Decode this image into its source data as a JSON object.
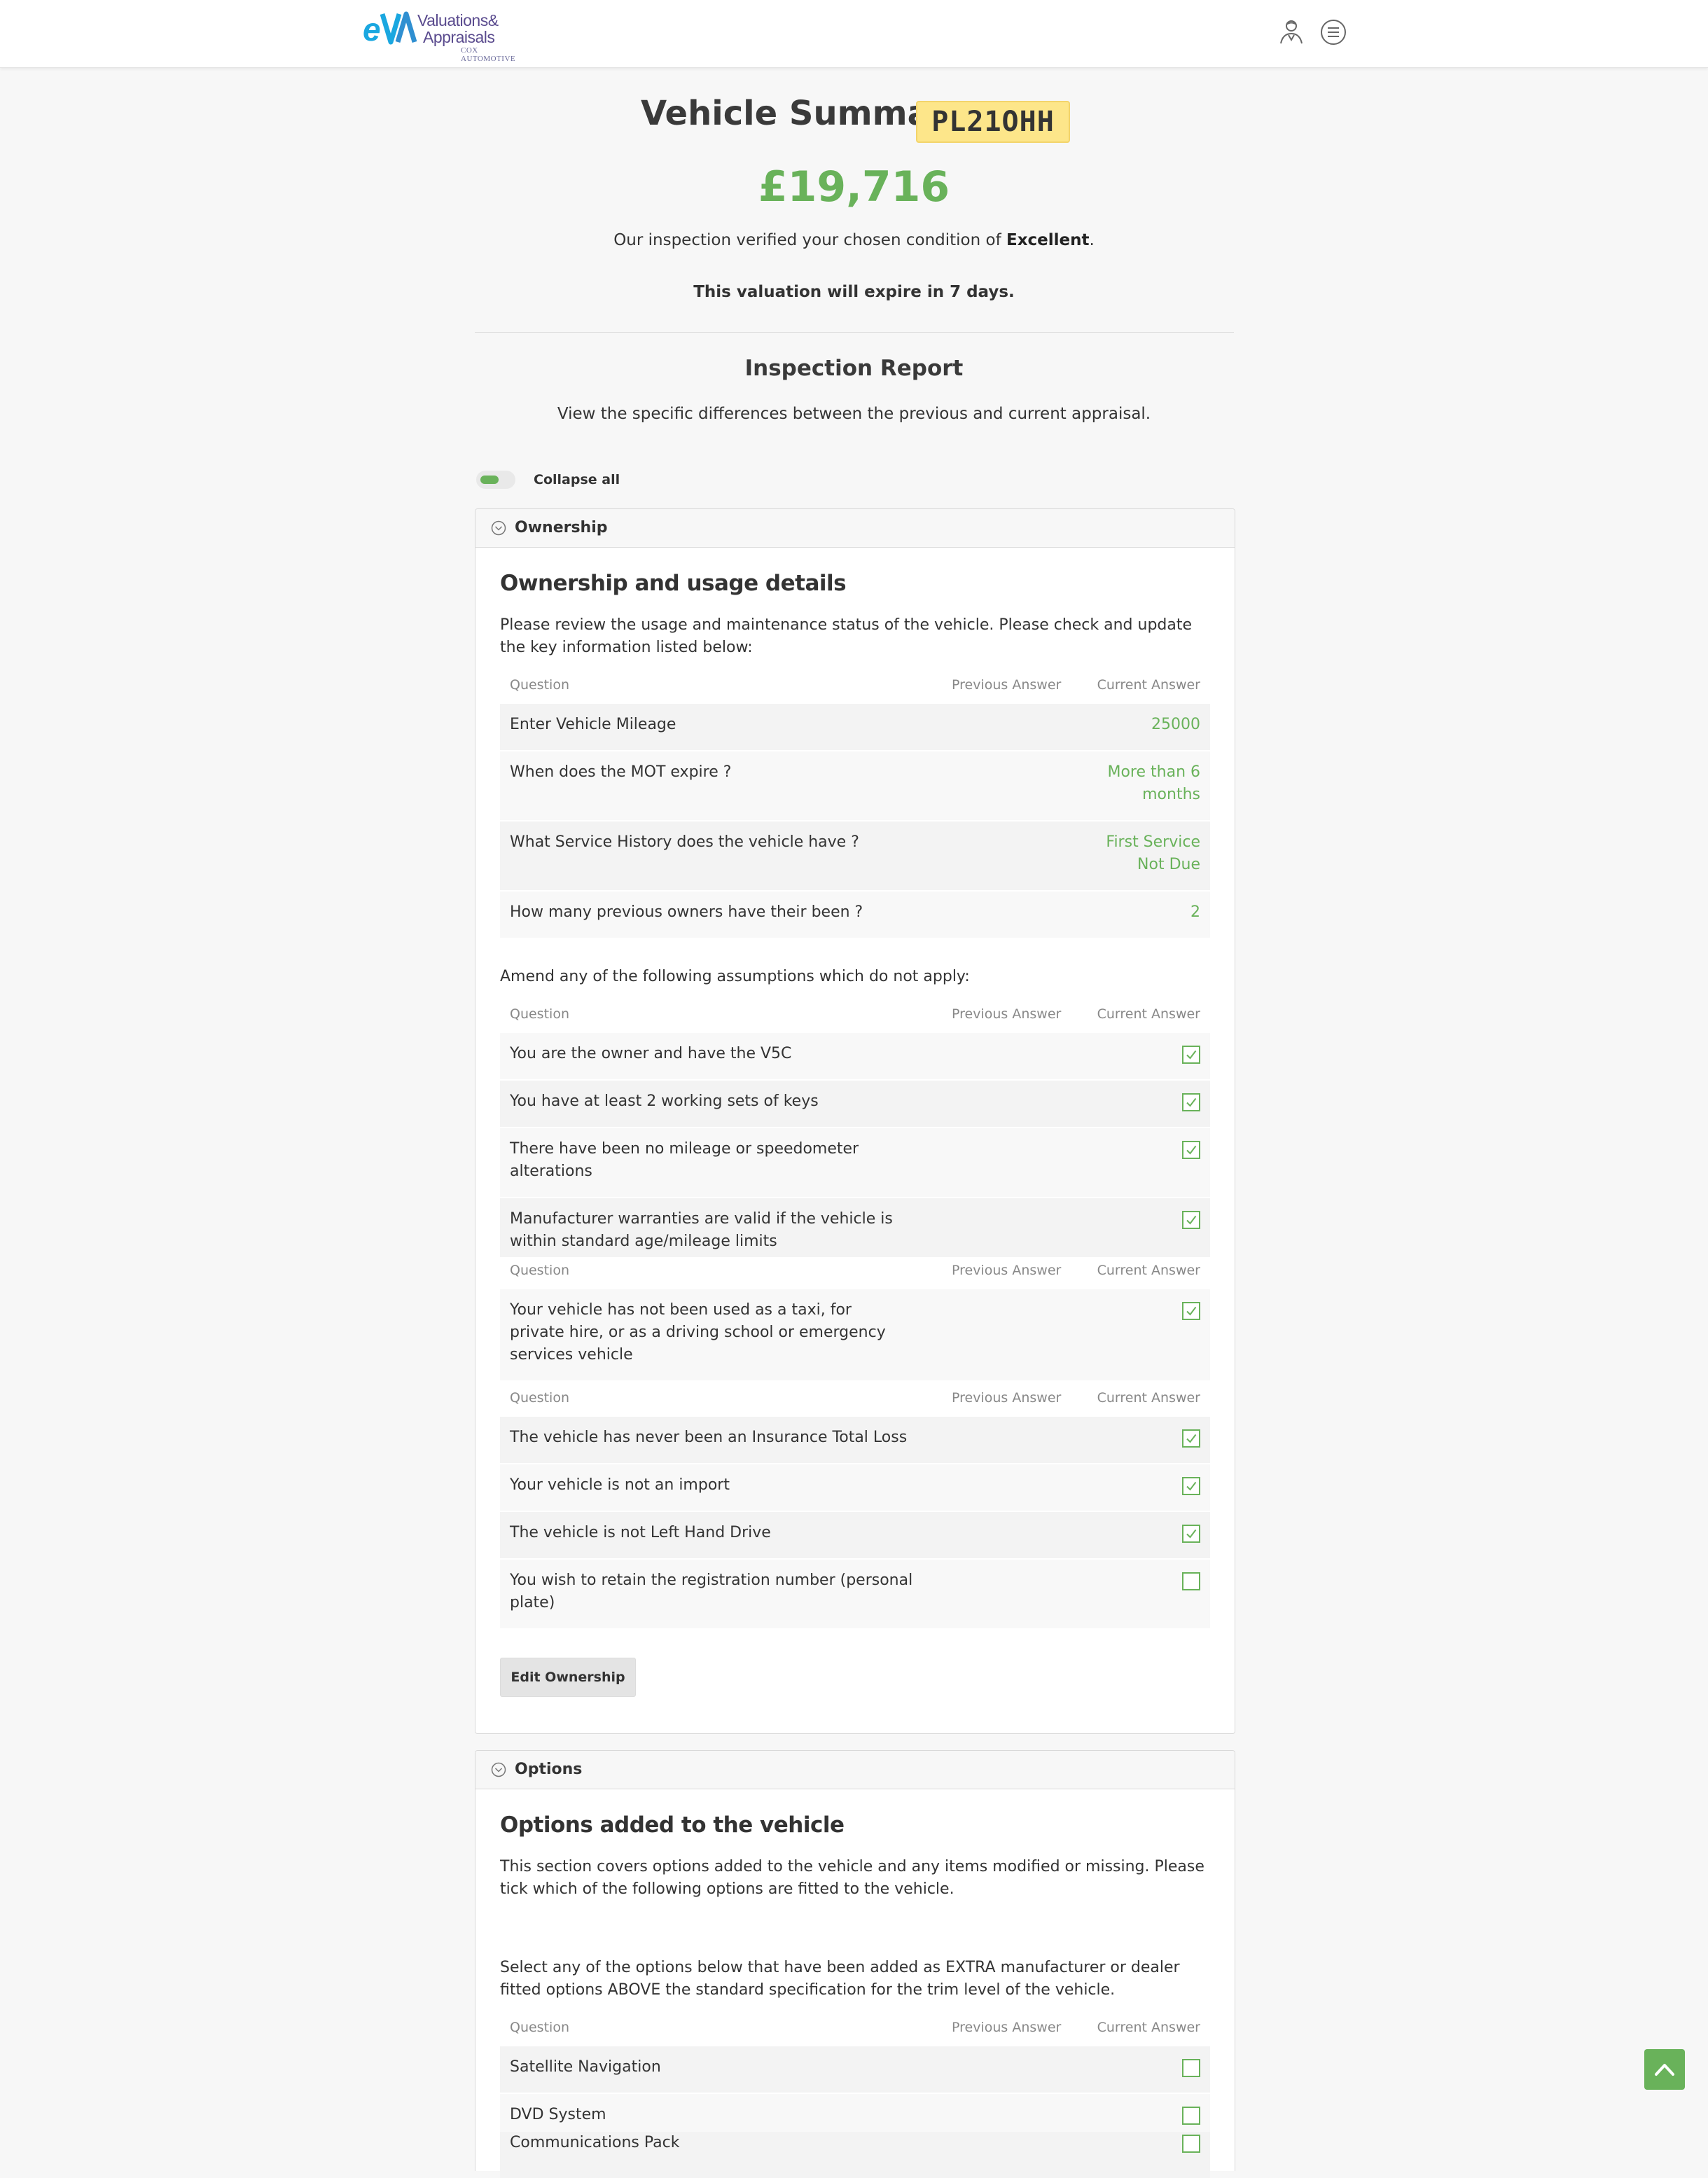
{
  "header": {
    "logo_line1": "Valuations&",
    "logo_line2": "Appraisals",
    "logo_line3": "COX AUTOMOTIVE",
    "icons": [
      "user-icon",
      "menu-icon"
    ]
  },
  "summary": {
    "title": "Vehicle Summary",
    "plate": "PL21OHH",
    "price": "£19,716",
    "condition_prefix": "Our inspection verified your chosen condition of ",
    "condition_value": "Excellent",
    "condition_suffix": ".",
    "expiry": "This valuation will expire in 7 days."
  },
  "report": {
    "title": "Inspection Report",
    "subtitle": "View the specific differences between the previous and current appraisal.",
    "collapse_label": "Collapse all",
    "collapse_on": true
  },
  "table_headers": {
    "question": "Question",
    "previous": "Previous Answer",
    "current": "Current Answer"
  },
  "ownership": {
    "panel_label": "Ownership",
    "title": "Ownership and usage details",
    "intro": "Please review the usage and maintenance status of the vehicle. Please check and update the key information listed below:",
    "rows": [
      {
        "question": "Enter Vehicle Mileage",
        "current": "25000"
      },
      {
        "question": "When does the MOT expire ?",
        "current": "More than 6 months"
      },
      {
        "question": "What Service History does the vehicle have ?",
        "current": "First Service Not Due"
      },
      {
        "question": "How many previous owners have their been ?",
        "current": "2"
      }
    ],
    "assumptions_intro": "Amend any of the following assumptions which do not apply:",
    "assumptions_1": [
      {
        "question": "You are the owner and have the V5C",
        "checked": true
      },
      {
        "question": "You have at least 2 working sets of keys",
        "checked": true
      },
      {
        "question": "There have been no mileage or speedometer alterations",
        "checked": true
      },
      {
        "question": "Manufacturer warranties are valid if the vehicle is within standard age/mileage limits",
        "checked": true
      }
    ],
    "assumptions_2": [
      {
        "question": "Your vehicle has not been used as a taxi, for private hire, or as a driving school or emergency services vehicle",
        "checked": true
      }
    ],
    "assumptions_3": [
      {
        "question": "The vehicle has never been an Insurance Total Loss",
        "checked": true
      },
      {
        "question": "Your vehicle is not an import",
        "checked": true
      },
      {
        "question": "The vehicle is not Left Hand Drive",
        "checked": true
      },
      {
        "question": "You wish to retain the registration number (personal plate)",
        "checked": false
      }
    ],
    "edit_label": "Edit Ownership"
  },
  "options": {
    "panel_label": "Options",
    "title": "Options added to the vehicle",
    "intro": "This section covers options added to the vehicle and any items modified or missing. Please tick which of the following options are fitted to the vehicle.",
    "select_intro": "Select any of the options below that have been added as EXTRA manufacturer or dealer fitted options ABOVE the standard specification for the trim level of the vehicle.",
    "rows": [
      {
        "question": "Satellite Navigation",
        "checked": false
      },
      {
        "question": "DVD System",
        "checked": false
      },
      {
        "question": "Communications Pack",
        "checked": false
      }
    ]
  },
  "colors": {
    "accent_green": "#69b25a",
    "plate_yellow": "#fde68a",
    "logo_blue": "#1aa7e0",
    "logo_purple": "#5a4b8e"
  }
}
